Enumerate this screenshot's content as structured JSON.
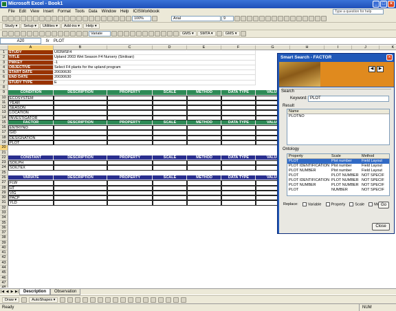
{
  "app": {
    "title": "Microsoft Excel - Book1",
    "help_placeholder": "Type a question for help",
    "menu": [
      "File",
      "Edit",
      "View",
      "Insert",
      "Format",
      "Tools",
      "Data",
      "Window",
      "Help",
      "ICISWorkbook"
    ],
    "zoom": "100%",
    "font": "Arial",
    "font_size": "9"
  },
  "toolbar3": {
    "study": "Study ▾",
    "setup": "Setup ▾",
    "utilities": "Utilities ▾",
    "addins": "Add-ins ▾",
    "help": "Help ▾"
  },
  "toolbar4": {
    "variate": "Variate",
    "gms": "GMS ▾",
    "smta": "SMTA ▾",
    "gms2": "GMS ▾"
  },
  "formula": {
    "cell_ref": "A20",
    "fx": "fx",
    "value": "PLOT"
  },
  "columns": [
    "A",
    "B",
    "C",
    "D",
    "E",
    "F",
    "G",
    "H",
    "I",
    "J",
    "K",
    "L"
  ],
  "study_info": [
    {
      "label": "STUDY",
      "value": "U03WSF4"
    },
    {
      "label": "TITLE",
      "value": "Upland 2003 Wet Season F4 Nursery (Siniloan)"
    },
    {
      "label": "PMKEY",
      "value": "-1"
    },
    {
      "label": "OBJECTIVE",
      "value": "Select F4 plants for the upland program"
    },
    {
      "label": "START DATE",
      "value": "20030630"
    },
    {
      "label": "END DATE",
      "value": "20030630"
    },
    {
      "label": "STUDY TYPE",
      "value": "E"
    }
  ],
  "headers": {
    "description": "DESCRIPTION",
    "property": "PROPERTY",
    "scale": "SCALE",
    "method": "METHOD",
    "data_type": "DATA TYPE",
    "value": "VALUE"
  },
  "sections": {
    "condition": {
      "title": "CONDITION",
      "rows": [
        "ECOSYSTEM",
        "YEAR",
        "SEASON",
        "LOCATION",
        "INVESTIGATOR"
      ]
    },
    "factor": {
      "title": "FACTOR",
      "rows": [
        "ENTRYNO",
        "GID",
        "DESIGNATION",
        "PLOT"
      ]
    },
    "constant": {
      "title": "CONSTANT",
      "rows": [
        "SOILPH",
        "SOILTEX"
      ]
    },
    "variate": {
      "title": "VARIATE",
      "rows": [
        "FLW",
        "HT",
        "VIG",
        "PACP",
        "YLD"
      ]
    }
  },
  "sheet_tabs": [
    "Description",
    "Observation"
  ],
  "drawbar": {
    "draw": "Draw ▾",
    "autoshapes": "AutoShapes ▾"
  },
  "status": {
    "ready": "Ready",
    "num": "NUM"
  },
  "dialog": {
    "title": "Smart Search - FACTOR",
    "search_group": "Search",
    "keyword_label": "Keyword:",
    "keyword_value": "PLOT",
    "result_label": "Result",
    "result_header": "Name",
    "result_items": [
      "PLOTNO"
    ],
    "ontology_label": "Ontology",
    "ontology_headers": [
      "Property",
      "Scale",
      "Method"
    ],
    "ontology_rows": [
      [
        "PLOT",
        "Plot number",
        "Field Layout"
      ],
      [
        "PLOT IDENTIFICATION",
        "Plot number",
        "Field Layout"
      ],
      [
        "PLOT NUMBER",
        "Plot number",
        "Field Layout"
      ],
      [
        "PLOT",
        "PLOT NUMBER",
        "NOT SPECIF"
      ],
      [
        "PLOT IDENTIFICATION",
        "PLOT NUMBER",
        "NOT SPECIF"
      ],
      [
        "PLOT NUMBER",
        "PLOT NUMBER",
        "NOT SPECIF"
      ],
      [
        "PLOT",
        "NUMBER",
        "NOT SPECIF"
      ]
    ],
    "replace_label": "Replace:",
    "replace_options": [
      "Variable",
      "Property",
      "Scale",
      "Method"
    ],
    "go_label": "Go",
    "close_label": "Close"
  }
}
